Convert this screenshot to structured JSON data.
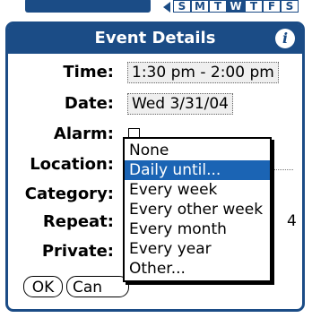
{
  "dialog": {
    "title": "Event Details",
    "info_icon": "i"
  },
  "fields": {
    "time_label": "Time:",
    "time_value": "1:30 pm - 2:00 pm",
    "date_label": "Date:",
    "date_value": "Wed 3/31/04",
    "alarm_label": "Alarm:",
    "alarm_checked": false,
    "location_label": "Location:",
    "category_label": "Category:",
    "repeat_label": "Repeat:",
    "repeat_partial": "4",
    "private_label": "Private:"
  },
  "buttons": {
    "ok_label": "OK",
    "cancel_label": "Can"
  },
  "repeat_menu": {
    "items": [
      "None",
      "Daily until...",
      "Every week",
      "Every other week",
      "Every month",
      "Every year",
      "Other..."
    ],
    "selected_index": 1
  },
  "background": {
    "week_days": [
      "S",
      "M",
      "T",
      "W",
      "T",
      "F",
      "S"
    ],
    "selected_day_index": 3
  },
  "colors": {
    "accent": "#1b4c86",
    "selection": "#1b64b4"
  }
}
